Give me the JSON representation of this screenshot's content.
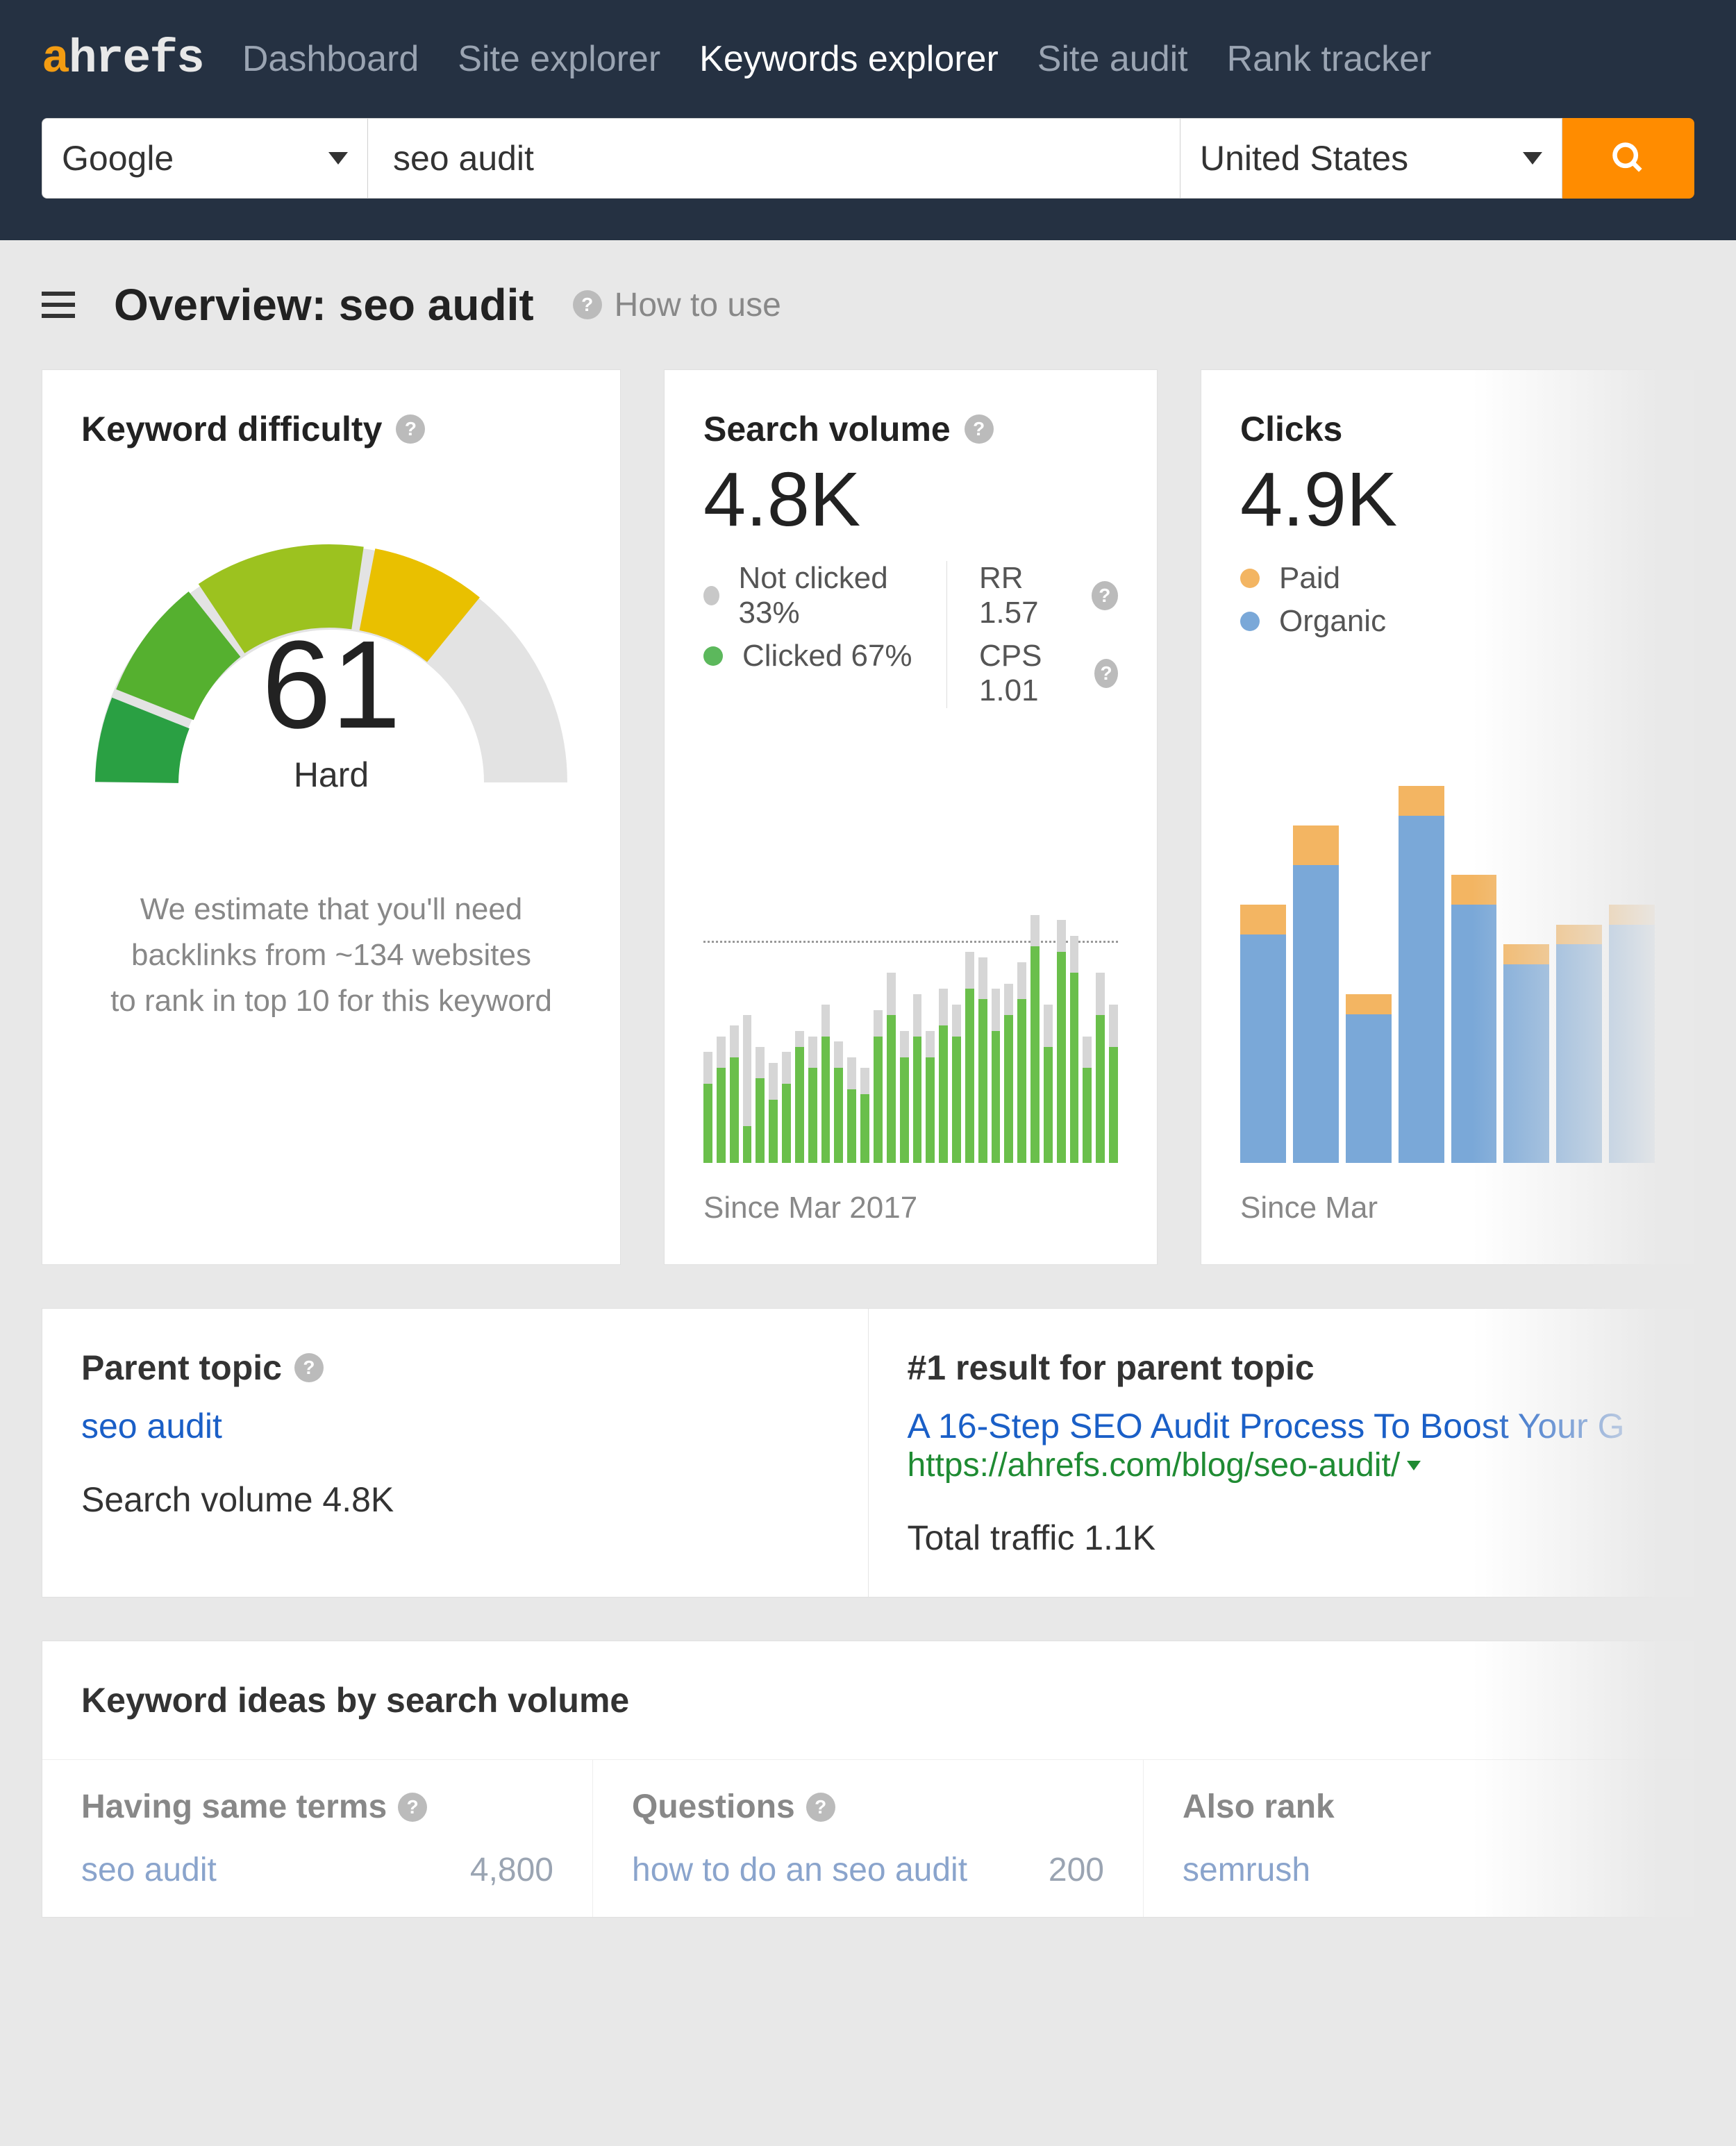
{
  "brand": {
    "a": "a",
    "rest": "hrefs"
  },
  "nav": {
    "items": [
      "Dashboard",
      "Site explorer",
      "Keywords explorer",
      "Site audit",
      "Rank tracker"
    ],
    "active_index": 2
  },
  "searchbar": {
    "engine": "Google",
    "keyword": "seo audit",
    "country": "United States"
  },
  "page": {
    "title": "Overview: seo audit",
    "how_to_use": "How to use"
  },
  "kd_card": {
    "title": "Keyword difficulty",
    "value": "61",
    "label": "Hard",
    "description_l1": "We estimate that you'll need",
    "description_l2": "backlinks from ~134 websites",
    "description_l3": "to rank in top 10 for this keyword"
  },
  "sv_card": {
    "title": "Search volume",
    "value": "4.8K",
    "not_clicked": "Not clicked 33%",
    "clicked": "Clicked 67%",
    "rr": "RR 1.57",
    "cps": "CPS 1.01",
    "since": "Since Mar 2017"
  },
  "clicks_card": {
    "title": "Clicks",
    "value": "4.9K",
    "paid": "Paid",
    "organic": "Organic",
    "since": "Since Mar"
  },
  "parent": {
    "left_title": "Parent topic",
    "topic": "seo audit",
    "left_sub": "Search volume 4.8K",
    "right_title": "#1 result for parent topic",
    "result_title": "A 16-Step SEO Audit Process To Boost Your G",
    "result_url": "https://ahrefs.com/blog/seo-audit/",
    "right_sub": "Total traffic 1.1K"
  },
  "ideas": {
    "title": "Keyword ideas by search volume",
    "cols": [
      {
        "heading": "Having same terms",
        "row_kw": "seo audit",
        "row_vol": "4,800"
      },
      {
        "heading": "Questions",
        "row_kw": "how to do an seo audit",
        "row_vol": "200"
      },
      {
        "heading": "Also rank",
        "row_kw": "semrush",
        "row_vol": ""
      }
    ]
  },
  "chart_data": {
    "type": "bar",
    "title": "Search volume trend",
    "since": "Mar 2017",
    "ylim": [
      0,
      100
    ],
    "series": [
      {
        "name": "total_bg_pct",
        "values": [
          42,
          48,
          52,
          56,
          44,
          38,
          42,
          50,
          48,
          60,
          46,
          40,
          36,
          58,
          72,
          50,
          64,
          50,
          66,
          60,
          80,
          78,
          66,
          68,
          76,
          94,
          60,
          92,
          86,
          48,
          72,
          60
        ]
      },
      {
        "name": "clicked_fg_pct",
        "values": [
          30,
          36,
          40,
          14,
          32,
          24,
          30,
          44,
          36,
          48,
          36,
          28,
          26,
          48,
          56,
          40,
          48,
          40,
          52,
          48,
          66,
          62,
          50,
          56,
          62,
          82,
          44,
          80,
          72,
          36,
          56,
          44
        ]
      }
    ]
  },
  "clicks_chart_data": {
    "type": "bar_stacked",
    "series": [
      {
        "name": "organic_pct",
        "values": [
          46,
          60,
          30,
          70,
          52,
          40,
          44,
          48
        ]
      },
      {
        "name": "paid_pct",
        "values": [
          6,
          8,
          4,
          6,
          6,
          4,
          4,
          4
        ]
      }
    ]
  }
}
